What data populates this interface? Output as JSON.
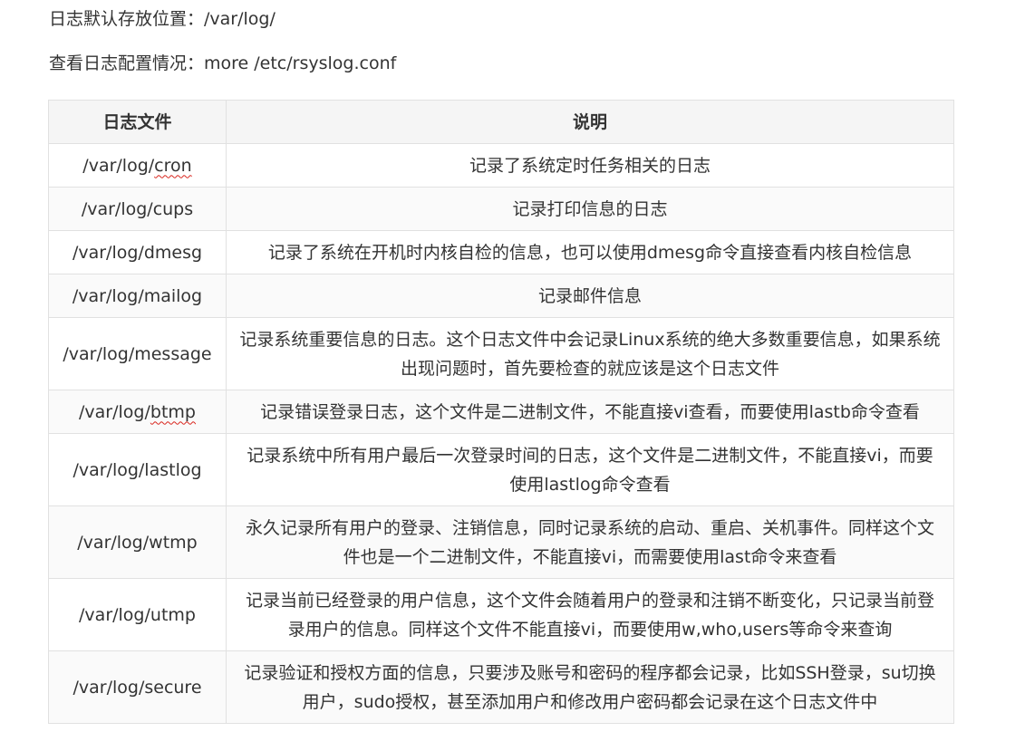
{
  "intro": {
    "default_location": "日志默认存放位置：/var/log/",
    "config_view": "查看日志配置情况：more /etc/rsyslog.conf"
  },
  "table": {
    "headers": [
      "日志文件",
      "说明"
    ],
    "rows": [
      {
        "file_prefix": "/var/log/",
        "file_word": "cron",
        "desc": "记录了系统定时任务相关的日志"
      },
      {
        "file_prefix": "",
        "file_word": "/var/log/cups",
        "desc": "记录打印信息的日志"
      },
      {
        "file_prefix": "",
        "file_word": "/var/log/dmesg",
        "desc": "记录了系统在开机时内核自检的信息，也可以使用dmesg命令直接查看内核自检信息"
      },
      {
        "file_prefix": "",
        "file_word": "/var/log/mailog",
        "desc": "记录邮件信息"
      },
      {
        "file_prefix": "",
        "file_word": "/var/log/message",
        "desc": "记录系统重要信息的日志。这个日志文件中会记录Linux系统的绝大多数重要信息，如果系统出现问题时，首先要检查的就应该是这个日志文件"
      },
      {
        "file_prefix": "/var/log/",
        "file_word": "btmp",
        "desc": "记录错误登录日志，这个文件是二进制文件，不能直接vi查看，而要使用lastb命令查看"
      },
      {
        "file_prefix": "",
        "file_word": "/var/log/lastlog",
        "desc": "记录系统中所有用户最后一次登录时间的日志，这个文件是二进制文件，不能直接vi，而要使用lastlog命令查看"
      },
      {
        "file_prefix": "",
        "file_word": "/var/log/wtmp",
        "desc": "永久记录所有用户的登录、注销信息，同时记录系统的启动、重启、关机事件。同样这个文件也是一个二进制文件，不能直接vi，而需要使用last命令来查看"
      },
      {
        "file_prefix": "",
        "file_word": "/var/log/utmp",
        "desc": "记录当前已经登录的用户信息，这个文件会随着用户的登录和注销不断变化，只记录当前登录用户的信息。同样这个文件不能直接vi，而要使用w,who,users等命令来查询"
      },
      {
        "file_prefix": "",
        "file_word": "/var/log/secure",
        "desc": "记录验证和授权方面的信息，只要涉及账号和密码的程序都会记录，比如SSH登录，su切换用户，sudo授权，甚至添加用户和修改用户密码都会记录在这个日志文件中"
      }
    ]
  }
}
